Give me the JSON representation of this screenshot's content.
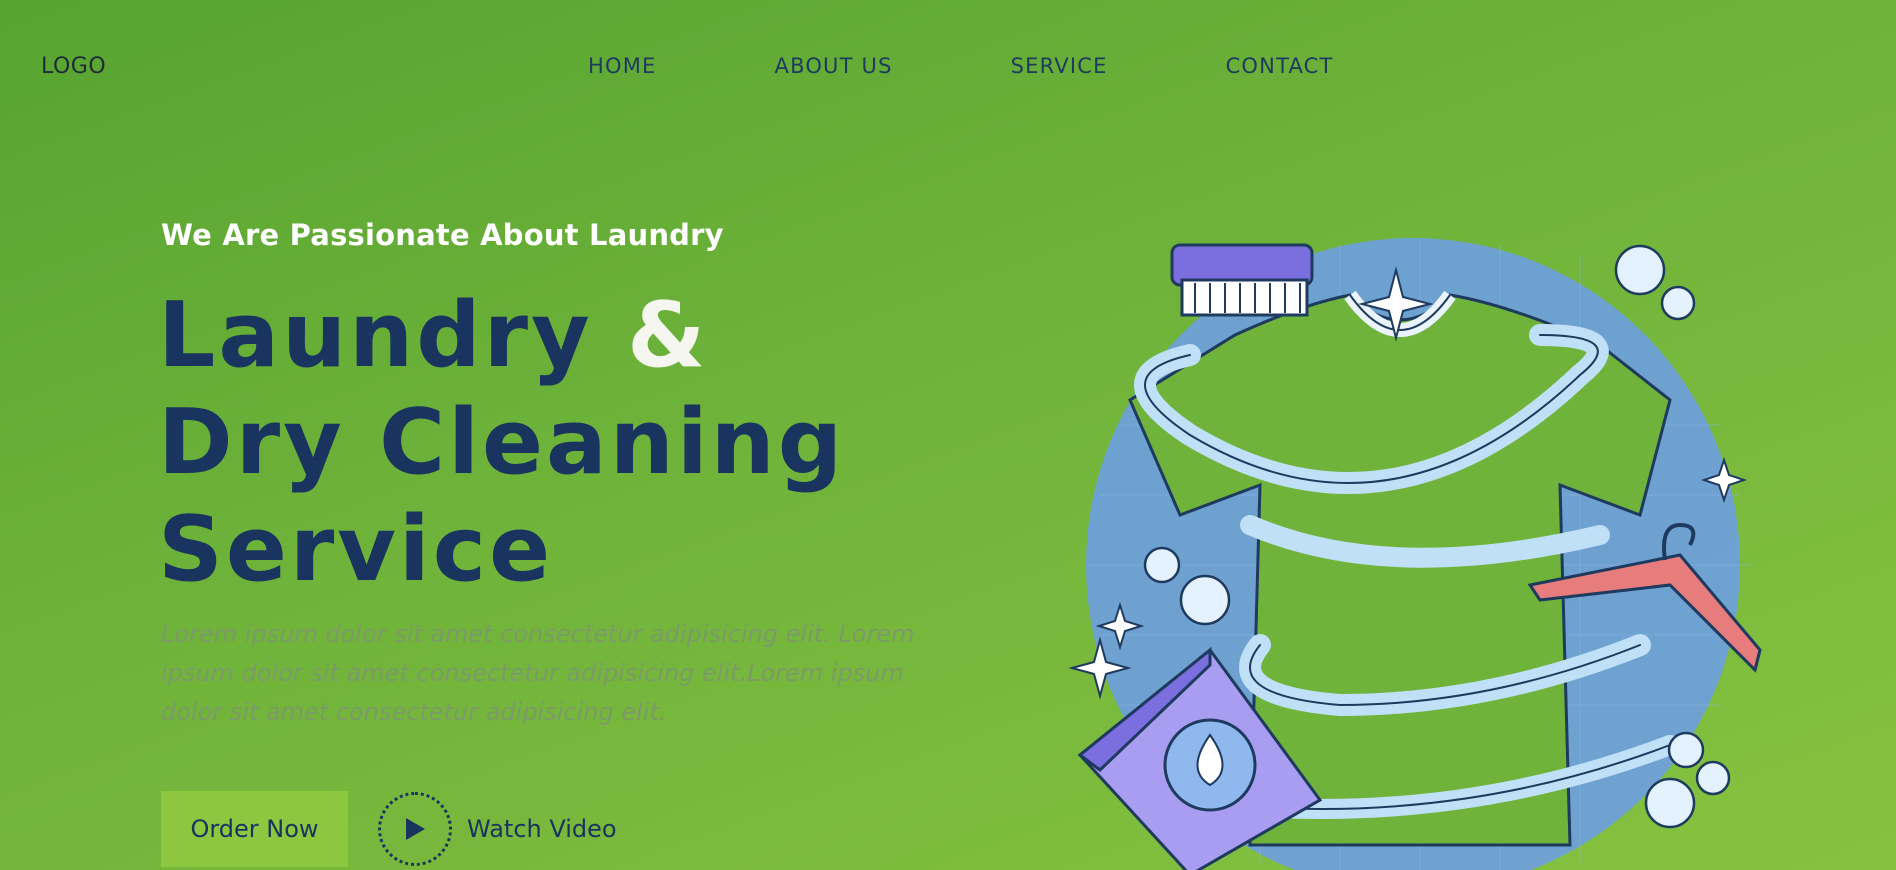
{
  "nav": {
    "logo": "LOGO",
    "links": [
      "HOME",
      "ABOUT US",
      "SERVICE",
      "CONTACT"
    ]
  },
  "hero": {
    "tagline": "We Are Passionate About Laundry",
    "headline_line1": "Laundry",
    "headline_amp": "&",
    "headline_line2": "Dry Cleaning",
    "headline_line3": "Service",
    "description": "Lorem ipsum dolor sit amet consectetur adipisicing elit. Lorem ipsum dolor sit amet consectetur adipisicing elit.Lorem ipsum dolor sit amet consectetur adipisicing elit.",
    "order_label": "Order Now",
    "watch_label": "Watch Video"
  },
  "icons": {
    "play": "play-icon",
    "illustration": "laundry-illustration"
  },
  "colors": {
    "accent": "#8dc63f",
    "heading": "#1a3460",
    "globe": "#6d9fe0"
  }
}
